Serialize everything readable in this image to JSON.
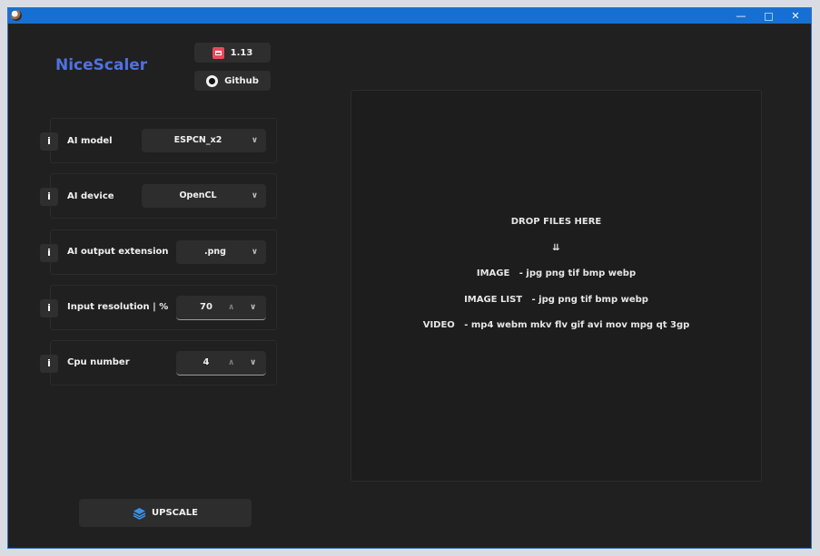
{
  "titlebar": {
    "minimize": "—",
    "close": "✕"
  },
  "brand": "NiceScaler",
  "header_buttons": {
    "version": "1.13",
    "github": "Github"
  },
  "settings": [
    {
      "label": "AI model",
      "value": "ESPCN_x2",
      "control": "dropdown"
    },
    {
      "label": "AI device",
      "value": "OpenCL",
      "control": "dropdown"
    },
    {
      "label": "AI output extension",
      "value": ".png",
      "control": "dropdown"
    },
    {
      "label": "Input resolution | %",
      "value": "70",
      "control": "spinbox"
    },
    {
      "label": "Cpu number",
      "value": "4",
      "control": "spinbox"
    }
  ],
  "info_label": "i",
  "drop_area": {
    "heading": "DROP FILES HERE",
    "arrow": "⇊",
    "image_line": "IMAGE   - jpg png tif bmp webp",
    "image_list_line": "IMAGE LIST   - jpg png tif bmp webp",
    "video_line": "VIDEO   - mp4 webm mkv flv gif avi mov mpg qt 3gp"
  },
  "upscale_button": "UPSCALE",
  "colors": {
    "titlebar": "#1670d4",
    "background": "#202020",
    "brand": "#4f72e0",
    "itch_icon": "#e94a5b",
    "upscale_icon": "#3b8fe8"
  }
}
